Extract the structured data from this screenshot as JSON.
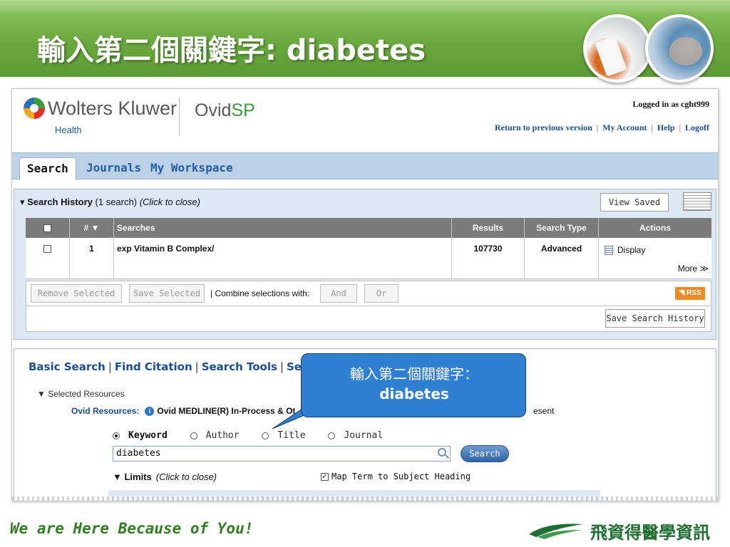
{
  "slide": {
    "title": "輸入第二個關鍵字: diabetes",
    "footer_text": "We are Here Because of You!",
    "brand": "飛資得醫學資訊"
  },
  "app": {
    "logo_brand": "Wolters Kluwer",
    "logo_sub": "Health",
    "product_name": "Ovid",
    "product_suffix": "SP",
    "logged_in": "Logged in as cght999",
    "links": [
      "Return to previous version",
      "My Account",
      "Help",
      "Logoff"
    ]
  },
  "tabs": [
    {
      "label": "Search",
      "active": true
    },
    {
      "label": "Journals",
      "active": false
    },
    {
      "label": "My Workspace",
      "active": false
    }
  ],
  "search_history": {
    "title": "Search History",
    "count": "(1 search)",
    "toggle": "(Click to close)",
    "view_saved": "View Saved",
    "columns": {
      "num": "# ▼",
      "searches": "Searches",
      "results": "Results",
      "type": "Search Type",
      "actions": "Actions"
    },
    "rows": [
      {
        "num": "1",
        "query": "exp Vitamin B Complex/",
        "results": "107730",
        "type": "Advanced",
        "action": "Display",
        "more": "More ≫"
      }
    ],
    "remove_selected": "Remove Selected",
    "save_selected": "Save Selected",
    "combine_label": "| Combine selections with:",
    "and_label": "And",
    "or_label": "Or",
    "rss": "RSS",
    "save_history": "Save Search History"
  },
  "search_panel": {
    "links": [
      "Basic Search",
      "Find Citation",
      "Search Tools",
      "Search Fi"
    ],
    "selected_resources": "▼ Selected Resources",
    "ovid_resources_label": "Ovid Resources:",
    "ovid_resource": "Ovid MEDLINE(R) In-Process & Ot",
    "present": "esent",
    "radios": [
      "Keyword",
      "Author",
      "Title",
      "Journal"
    ],
    "query_value": "diabetes",
    "search_button": "Search",
    "limits": "▼ Limits",
    "limits_toggle": "(Click to close)",
    "map_term": "Map Term to Subject Heading"
  },
  "callout": {
    "line1": "輸入第二個關鍵字：",
    "line2": "diabetes"
  },
  "colors": {
    "header_green": "#6aa93e",
    "link_blue": "#1a4e99",
    "callout_blue": "#2f7fd3",
    "footer_green": "#2f7f1f"
  }
}
